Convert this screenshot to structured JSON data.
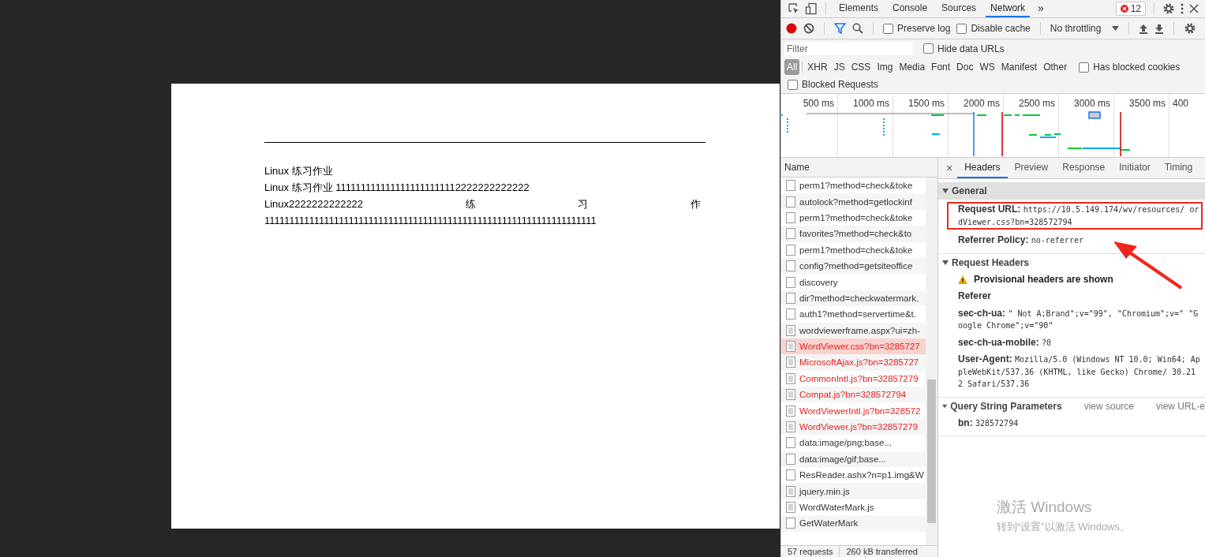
{
  "document": {
    "lines": [
      {
        "kind": "text",
        "text": "Linux 练习作业"
      },
      {
        "kind": "text",
        "text": "Linux 练习作业 1111111111111111111111112222222222222"
      },
      {
        "kind": "justified",
        "words": [
          "Linux2222222222222",
          "练",
          "习",
          "作"
        ]
      },
      {
        "kind": "text",
        "text": "1111111111111111111111111111111111111111111111111111111111111111111"
      }
    ]
  },
  "devtools": {
    "tabs": [
      {
        "label": "Elements",
        "selected": false
      },
      {
        "label": "Console",
        "selected": false
      },
      {
        "label": "Sources",
        "selected": false
      },
      {
        "label": "Network",
        "selected": true
      }
    ],
    "more_tabs": "»",
    "error_count": "12",
    "toolbar": {
      "recording": true,
      "checkboxes": [
        {
          "label": "Preserve log",
          "checked": false
        },
        {
          "label": "Disable cache",
          "checked": false
        }
      ],
      "throttling": "No throttling"
    },
    "filter": {
      "placeholder": "Filter",
      "hide_data_urls": {
        "label": "Hide data URLs",
        "checked": false
      }
    },
    "types": [
      {
        "label": "All",
        "selected": true
      },
      {
        "label": "XHR",
        "selected": false
      },
      {
        "label": "JS",
        "selected": false
      },
      {
        "label": "CSS",
        "selected": false
      },
      {
        "label": "Img",
        "selected": false
      },
      {
        "label": "Media",
        "selected": false
      },
      {
        "label": "Font",
        "selected": false
      },
      {
        "label": "Doc",
        "selected": false
      },
      {
        "label": "WS",
        "selected": false
      },
      {
        "label": "Manifest",
        "selected": false
      },
      {
        "label": "Other",
        "selected": false
      }
    ],
    "has_blocked_cookies": {
      "label": "Has blocked cookies",
      "checked": false
    },
    "blocked_requests": {
      "label": "Blocked Requests",
      "checked": false
    },
    "overview_ticks": [
      "500 ms",
      "1000 ms",
      "1500 ms",
      "2000 ms",
      "2500 ms",
      "3000 ms",
      "3500 ms",
      "400"
    ],
    "name_header": "Name",
    "requests": [
      {
        "name": "perm1?method=check&toke",
        "kind": "plain",
        "failed": false,
        "selected": false
      },
      {
        "name": "autolock?method=getlockinf",
        "kind": "plain",
        "failed": false,
        "selected": false
      },
      {
        "name": "perm1?method=check&toke",
        "kind": "plain",
        "failed": false,
        "selected": false
      },
      {
        "name": "favorites?method=check&to",
        "kind": "plain",
        "failed": false,
        "selected": false
      },
      {
        "name": "perm1?method=check&toke",
        "kind": "plain",
        "failed": false,
        "selected": false
      },
      {
        "name": "config?method=getsiteoffice",
        "kind": "plain",
        "failed": false,
        "selected": false
      },
      {
        "name": "discovery",
        "kind": "plain",
        "failed": false,
        "selected": false
      },
      {
        "name": "dir?method=checkwatermark.",
        "kind": "plain",
        "failed": false,
        "selected": false
      },
      {
        "name": "auth1?method=servertime&t.",
        "kind": "plain",
        "failed": false,
        "selected": false
      },
      {
        "name": "wordviewerframe.aspx?ui=zh-",
        "kind": "document",
        "failed": false,
        "selected": false
      },
      {
        "name": "WordViewer.css?bn=3285727",
        "kind": "document",
        "failed": true,
        "selected": true
      },
      {
        "name": "MicrosoftAjax.js?bn=3285727",
        "kind": "document",
        "failed": true,
        "selected": false
      },
      {
        "name": "CommonIntl.js?bn=32857279",
        "kind": "document",
        "failed": true,
        "selected": false
      },
      {
        "name": "Compat.js?bn=328572794",
        "kind": "document",
        "failed": true,
        "selected": false
      },
      {
        "name": "WordViewerIntl.js?bn=328572",
        "kind": "document",
        "failed": true,
        "selected": false
      },
      {
        "name": "WordViewer.js?bn=32857279",
        "kind": "document",
        "failed": true,
        "selected": false
      },
      {
        "name": "data:image/png;base...",
        "kind": "plain",
        "failed": false,
        "selected": false
      },
      {
        "name": "data:image/gif;base...",
        "kind": "plain",
        "failed": false,
        "selected": false
      },
      {
        "name": "ResReader.ashx?n=p1.img&W",
        "kind": "plain",
        "failed": false,
        "selected": false
      },
      {
        "name": "jquery.min.js",
        "kind": "document",
        "failed": false,
        "selected": false
      },
      {
        "name": "WordWaterMark.js",
        "kind": "document",
        "failed": false,
        "selected": false
      },
      {
        "name": "GetWaterMark",
        "kind": "plain",
        "failed": false,
        "selected": false
      }
    ],
    "status": [
      "57 requests",
      "260 kB transferred"
    ],
    "detail_close": "×",
    "detail_tabs": [
      {
        "label": "Headers",
        "selected": true
      },
      {
        "label": "Preview",
        "selected": false
      },
      {
        "label": "Response",
        "selected": false
      },
      {
        "label": "Initiator",
        "selected": false
      },
      {
        "label": "Timing",
        "selected": false
      }
    ],
    "sections": [
      {
        "title": "General",
        "expanded": true,
        "entries": [
          {
            "kind": "pair",
            "key": "Request URL:",
            "value": "https://10.5.149.174/wv/resources/ ordViewer.css?bn=328572794",
            "highlighted": true
          },
          {
            "kind": "pair",
            "key": "Referrer Policy:",
            "value": "no-referrer",
            "highlighted": false
          }
        ]
      },
      {
        "title": "Request Headers",
        "expanded": true,
        "entries": [
          {
            "kind": "warning",
            "key": "Provisional headers are shown"
          },
          {
            "kind": "label",
            "key": "Referer"
          },
          {
            "kind": "pair",
            "key": "sec-ch-ua:",
            "value": "\" Not A;Brand\";v=\"99\", \"Chromium\";v=\" \"Google Chrome\";v=\"90\"",
            "highlighted": false
          },
          {
            "kind": "pair",
            "key": "sec-ch-ua-mobile:",
            "value": "?0",
            "highlighted": false
          },
          {
            "kind": "pair",
            "key": "User-Agent:",
            "value": "Mozilla/5.0 (Windows NT 10.0; Win64; AppleWebKit/537.36 (KHTML, like Gecko) Chrome/ 30.212 Safari/537.36",
            "highlighted": false
          }
        ]
      },
      {
        "title": "Query String Parameters",
        "expanded": true,
        "links": [
          "view source",
          "view URL-e"
        ],
        "entries": [
          {
            "kind": "pair",
            "key": "bn:",
            "value": "328572794",
            "highlighted": false
          }
        ]
      }
    ]
  },
  "activation_notice": {
    "title": "激活 Windows",
    "subtitle": "转到“设置”以激活 Windows。"
  }
}
